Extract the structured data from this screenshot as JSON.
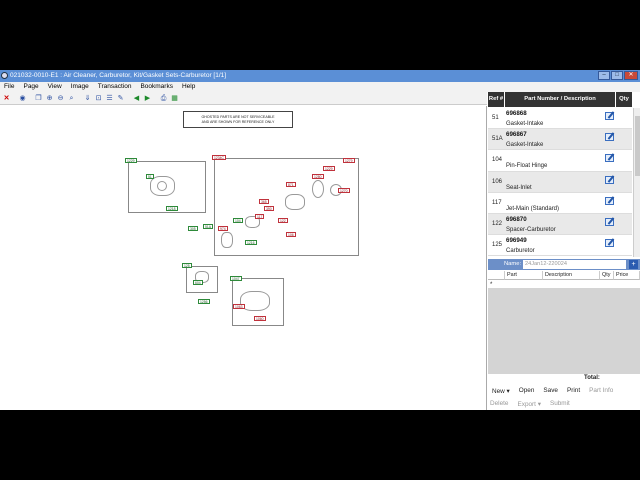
{
  "window": {
    "title": "021032-0010-E1 : Air Cleaner, Carburetor, Kit/Gasket Sets-Carburetor [1/1]",
    "controls": [
      "–",
      "□",
      "✕"
    ]
  },
  "menu": [
    "File",
    "Page",
    "View",
    "Image",
    "Transaction",
    "Bookmarks",
    "Help"
  ],
  "diagram": {
    "notice_line1": "GHOSTED PARTS ARE NOT SERVICEABLE",
    "notice_line2": "AND ARE SHOWN FOR REFERENCE ONLY",
    "green_tags": [
      "1229",
      "51",
      "1218",
      "104",
      "305",
      "51A",
      "1216",
      "125",
      "604",
      "1256",
      "1047"
    ],
    "red_tags": [
      "1234C",
      "1279",
      "1229",
      "871",
      "1280",
      "1270",
      "365",
      "390",
      "117",
      "122",
      "106",
      "974",
      "1063",
      "1060"
    ]
  },
  "parts_panel": {
    "columns": {
      "ref": "Ref #",
      "part": "Part Number / Description",
      "qty": "Qty"
    },
    "rows": [
      {
        "ref": "51",
        "number": "696868",
        "desc": "Gasket-Intake"
      },
      {
        "ref": "51A",
        "number": "696867",
        "desc": "Gasket-Intake"
      },
      {
        "ref": "104",
        "number": "",
        "desc": "Pin-Float Hinge"
      },
      {
        "ref": "106",
        "number": "",
        "desc": "Seat-Inlet"
      },
      {
        "ref": "117",
        "number": "",
        "desc": "Jet-Main (Standard)"
      },
      {
        "ref": "122",
        "number": "696870",
        "desc": "Spacer-Carburetor"
      },
      {
        "ref": "125",
        "number": "696949",
        "desc": "Carburetor"
      }
    ]
  },
  "order": {
    "name_label": "Name:",
    "name_value": "24Jan12-220024",
    "columns": [
      "Part",
      "Description",
      "Qty",
      "Price"
    ],
    "new_row_marker": "*",
    "total_label": "Total:",
    "actions_row1": [
      {
        "label": "New ▾",
        "enabled": true
      },
      {
        "label": "Open",
        "enabled": true
      },
      {
        "label": "Save",
        "enabled": true
      },
      {
        "label": "Print",
        "enabled": true
      },
      {
        "label": "Part Info",
        "enabled": false
      }
    ],
    "actions_row2": [
      {
        "label": "Delete",
        "enabled": false
      },
      {
        "label": "Export ▾",
        "enabled": false
      },
      {
        "label": "Submit",
        "enabled": false
      }
    ]
  }
}
